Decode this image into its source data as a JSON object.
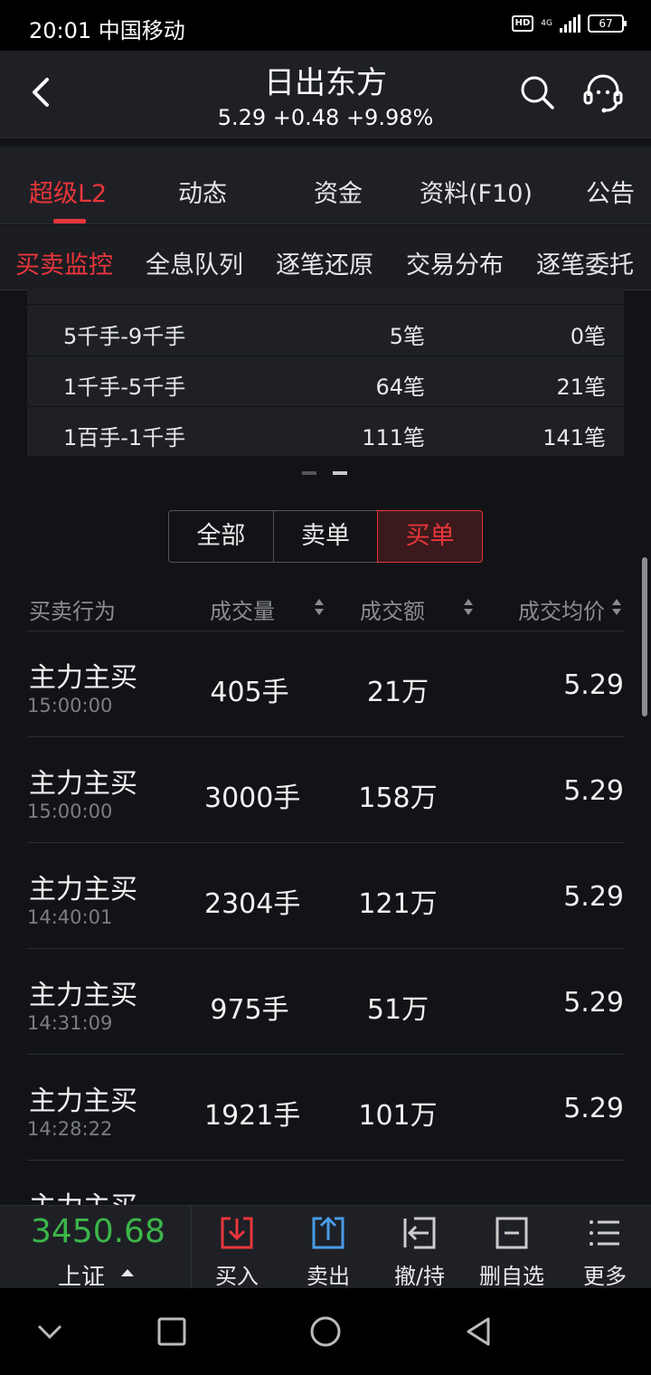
{
  "status": {
    "time": "20:01 中国移动",
    "hd": "HD",
    "net": "4G",
    "battery": "67"
  },
  "header": {
    "title": "日出东方",
    "quote": "5.29  +0.48  +9.98%"
  },
  "tabs_main": [
    "超级L2",
    "动态",
    "资金",
    "资料(F10)",
    "公告"
  ],
  "tabs_sub": [
    "买卖监控",
    "全息队列",
    "逐笔还原",
    "交易分布",
    "逐笔委托"
  ],
  "size_table": [
    {
      "range": "5千手-9千手",
      "buy": "5笔",
      "sell": "0笔"
    },
    {
      "range": "1千手-5千手",
      "buy": "64笔",
      "sell": "21笔"
    },
    {
      "range": "1百手-1千手",
      "buy": "111笔",
      "sell": "141笔"
    }
  ],
  "filter": {
    "all": "全部",
    "sell": "卖单",
    "buy": "买单",
    "selected": "买单"
  },
  "columns": {
    "action": "买卖行为",
    "volume": "成交量",
    "amount": "成交额",
    "avg_price": "成交均价"
  },
  "trades": [
    {
      "action": "主力主买",
      "time": "15:00:00",
      "volume": "405手",
      "amount": "21万",
      "price": "5.29"
    },
    {
      "action": "主力主买",
      "time": "15:00:00",
      "volume": "3000手",
      "amount": "158万",
      "price": "5.29"
    },
    {
      "action": "主力主买",
      "time": "14:40:01",
      "volume": "2304手",
      "amount": "121万",
      "price": "5.29"
    },
    {
      "action": "主力主买",
      "time": "14:31:09",
      "volume": "975手",
      "amount": "51万",
      "price": "5.29"
    },
    {
      "action": "主力主买",
      "time": "14:28:22",
      "volume": "1921手",
      "amount": "101万",
      "price": "5.29"
    },
    {
      "action": "主力主买",
      "time": "",
      "volume": "",
      "amount": "",
      "price": ""
    }
  ],
  "index": {
    "value": "3450.68",
    "name": "上证"
  },
  "toolbar": {
    "buy": "买入",
    "sell": "卖出",
    "cancel": "撤/持",
    "remove_watch": "删自选",
    "more": "更多"
  },
  "colors": {
    "red": "#e8363a",
    "green": "#3cb649",
    "blue": "#4a9be8"
  }
}
